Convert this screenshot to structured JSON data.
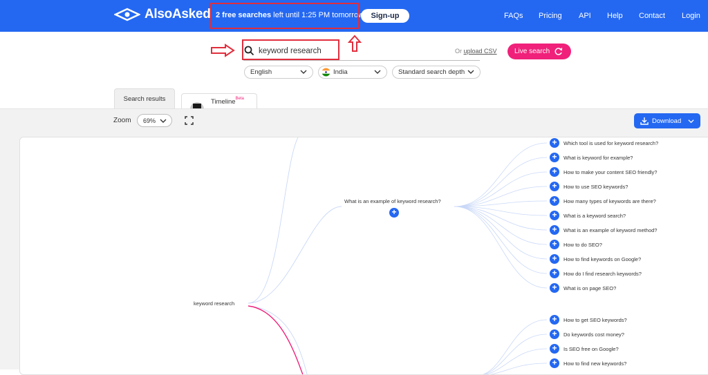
{
  "header": {
    "logo_text": "AlsoAsked",
    "banner_bold": "2 free searches",
    "banner_rest": " left until 1:25 PM tomorrow",
    "signup_label": "Sign-up",
    "nav": [
      "FAQs",
      "Pricing",
      "API",
      "Help",
      "Contact",
      "Login"
    ]
  },
  "search": {
    "query": "keyword research",
    "or_text": "Or ",
    "upload_label": "upload CSV",
    "live_label": "Live search",
    "language": "English",
    "country": "India",
    "depth": "Standard search depth"
  },
  "tabs": {
    "results": "Search results",
    "timeline": "Timeline",
    "beta": "Beta"
  },
  "toolbar": {
    "zoom_label": "Zoom",
    "zoom_value": "69%",
    "download_label": "Download"
  },
  "tree": {
    "root": "keyword research",
    "branch": "What is an example of keyword research?",
    "leaves_a": [
      "Which tool is used for keyword research?",
      "What is keyword for example?",
      "How to make your content SEO friendly?",
      "How to use SEO keywords?",
      "How many types of keywords are there?",
      "What is a keyword search?",
      "What is an example of keyword method?",
      "How to do SEO?",
      "How to find keywords on Google?",
      "How do I find research keywords?",
      "What is on page SEO?"
    ],
    "leaves_b": [
      "How to get SEO keywords?",
      "Do keywords cost money?",
      "Is SEO free on Google?",
      "How to find new keywords?"
    ]
  },
  "colors": {
    "brand": "#2468f2",
    "accent": "#f0217a",
    "annotation": "#e12d3c"
  }
}
